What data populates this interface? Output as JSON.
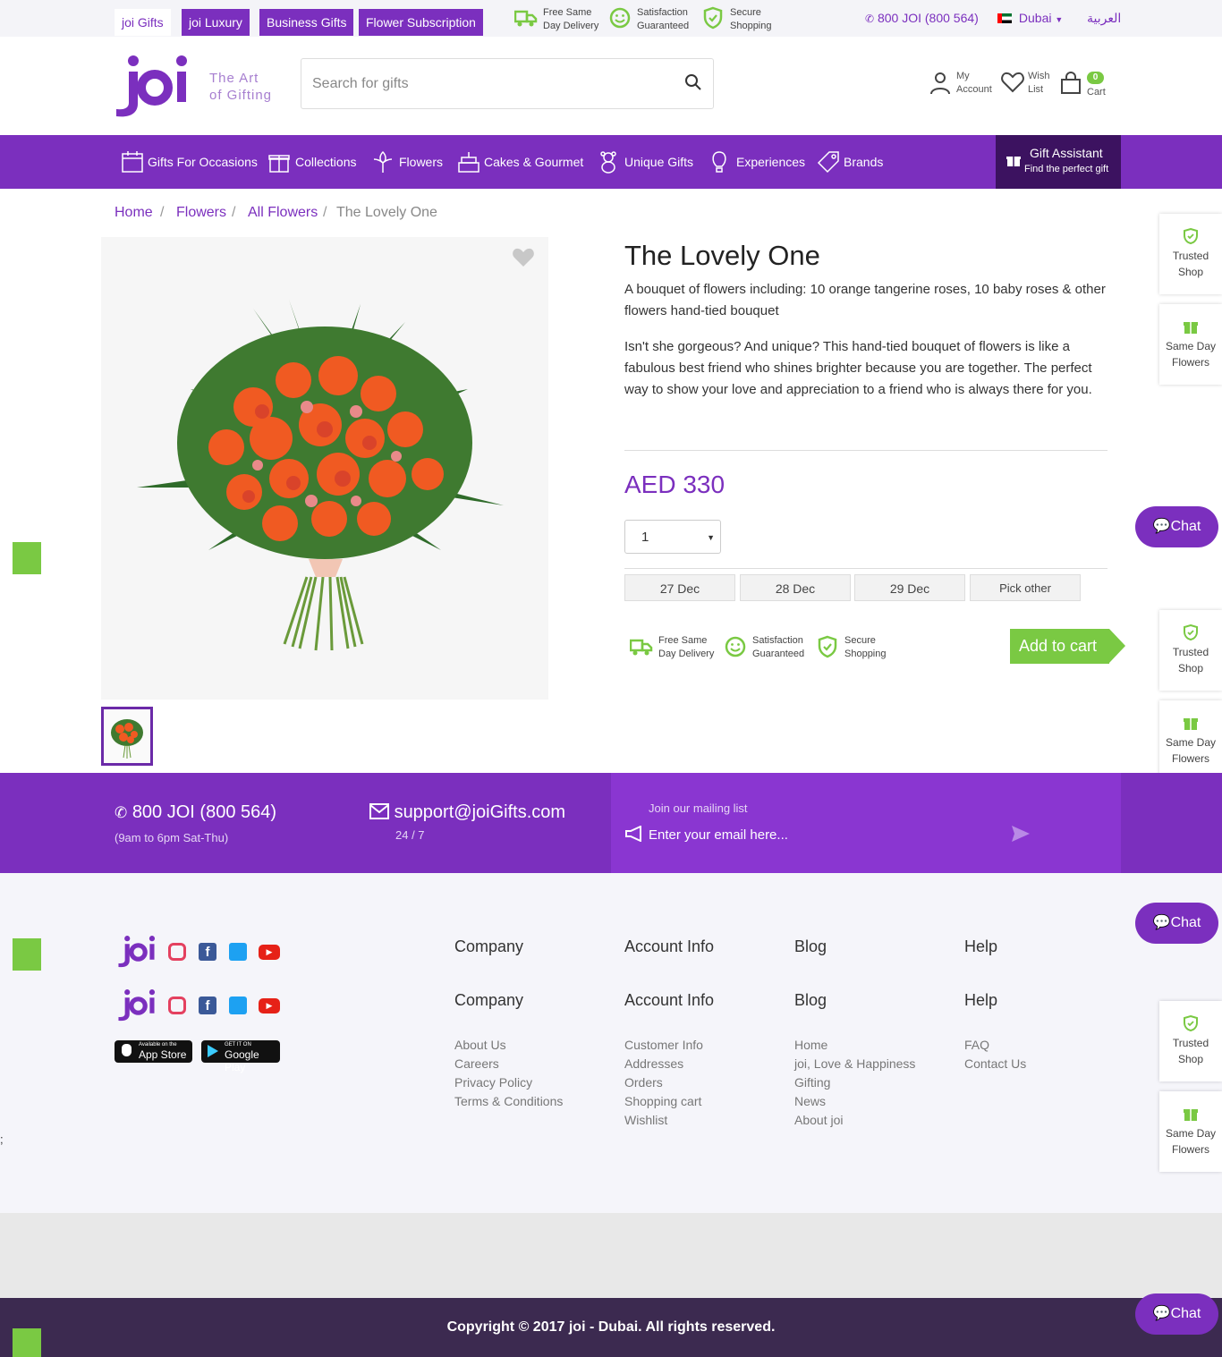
{
  "topbar": {
    "tabs": [
      "joi Gifts",
      "joi Luxury",
      "Business Gifts",
      "Flower Subscription"
    ],
    "features": [
      {
        "line1": "Free Same",
        "line2": "Day Delivery",
        "icon": "truck-icon"
      },
      {
        "line1": "Satisfaction",
        "line2": "Guaranteed",
        "icon": "smile-icon"
      },
      {
        "line1": "Secure",
        "line2": "Shopping",
        "icon": "shield-icon"
      }
    ],
    "phone": "800 JOI (800 564)",
    "city": "Dubai",
    "language": "العربية"
  },
  "header": {
    "logo_text": "joi",
    "tagline_1": "The Art",
    "tagline_2": "of Gifting",
    "search_placeholder": "Search for gifts",
    "account_1": "My",
    "account_2": "Account",
    "wish_1": "Wish",
    "wish_2": "List",
    "cart_label": "Cart",
    "cart_count": "0"
  },
  "nav": {
    "items": [
      "Gifts For Occasions",
      "Collections",
      "Flowers",
      "Cakes & Gourmet",
      "Unique Gifts",
      "Experiences",
      "Brands"
    ],
    "assistant_title": "Gift Assistant",
    "assistant_sub": "Find the perfect gift"
  },
  "breadcrumb": [
    "Home",
    "Flowers",
    "All Flowers",
    "The Lovely One"
  ],
  "product": {
    "title": "The Lovely One",
    "summary": "A bouquet of flowers including: 10 orange tangerine roses, 10 baby roses & other flowers hand-tied bouquet",
    "description": "Isn't she gorgeous?  And unique? This hand-tied bouquet of flowers is like a fabulous best friend who shines brighter because you are together.  The perfect way to show your love and appreciation to a friend who is always there for you.",
    "price": "AED 330",
    "quantity": "1",
    "dates": [
      "27 Dec",
      "28 Dec",
      "29 Dec",
      "Pick other"
    ],
    "add_to_cart": "Add to cart"
  },
  "side": {
    "trusted_1": "Trusted",
    "trusted_2": "Shop",
    "sameday_1": "Same Day",
    "sameday_2": "Flowers",
    "chat": "Chat"
  },
  "contact": {
    "phone": "800 JOI (800 564)",
    "hours": "(9am to 6pm Sat-Thu)",
    "email": "support@joiGifts.com",
    "email_hours": "24 / 7",
    "mailing_label": "Join our mailing list",
    "mailing_placeholder": "Enter your email here..."
  },
  "footer": {
    "headings": [
      "Company",
      "Account Info",
      "Blog",
      "Help"
    ],
    "company": [
      "About Us",
      "Careers",
      "Privacy Policy",
      "Terms & Conditions"
    ],
    "account": [
      "Customer Info",
      "Addresses",
      "Orders",
      "Shopping cart",
      "Wishlist"
    ],
    "blog": [
      "Home",
      "joi, Love & Happiness",
      "Gifting",
      "News",
      "About joi"
    ],
    "help": [
      "FAQ",
      "Contact Us"
    ],
    "appstore_small": "Available on the",
    "appstore": "App Store",
    "googleplay_small": "GET IT ON",
    "googleplay": "Google Play",
    "stray": ";"
  },
  "copyright": "Copyright © 2017 joi - Dubai. All rights reserved.",
  "colors": {
    "brand": "#7b2fbe",
    "accent": "#7ac943",
    "dark": "#3c2a50"
  }
}
